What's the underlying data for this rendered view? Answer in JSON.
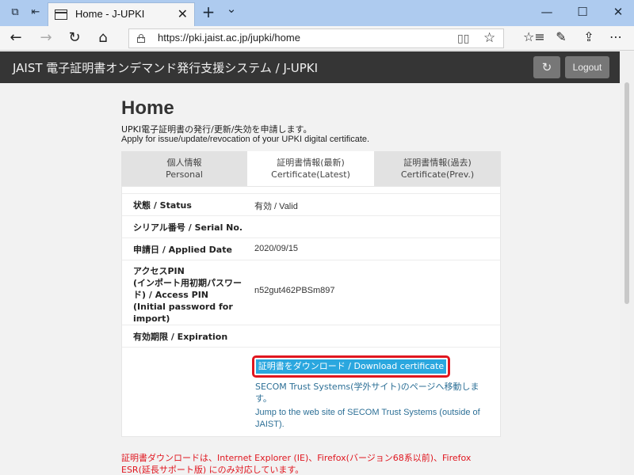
{
  "browser": {
    "tab_title": "Home - J-UPKI",
    "tab_close": "✕",
    "new_tab": "+",
    "tab_menu": "⌄",
    "url": "https://pki.jaist.ac.jp/jupki/home",
    "window_min": "—",
    "window_max": "☐",
    "window_close": "✕"
  },
  "app": {
    "title": "JAIST 電子証明書オンデマンド発行支援システム / J-UPKI",
    "refresh_icon": "↻",
    "logout_label": "Logout"
  },
  "page": {
    "heading": "Home",
    "desc_ja": "UPKI電子証明書の発行/更新/失効を申請します。",
    "desc_en": "Apply for issue/update/revocation of your UPKI digital certificate."
  },
  "tabs": [
    {
      "ja": "個人情報",
      "en": "Personal"
    },
    {
      "ja": "証明書情報(最新)",
      "en": "Certificate(Latest)"
    },
    {
      "ja": "証明書情報(過去)",
      "en": "Certificate(Prev.)"
    }
  ],
  "rows": [
    {
      "label": "状態 / Status",
      "value": "有効 / Valid"
    },
    {
      "label": "シリアル番号 / Serial No.",
      "value": ""
    },
    {
      "label": "申請日 / Applied Date",
      "value": "2020/09/15"
    },
    {
      "label": "アクセスPIN\n(インポート用初期パスワード) / Access PIN\n(Initial password for import)",
      "value": "n52gut462PBSm897"
    },
    {
      "label": "有効期限 / Expiration",
      "value": ""
    }
  ],
  "download": {
    "button": "証明書をダウンロード / Download certificate",
    "secom_ja": "SECOM Trust Systems(学外サイト)のページへ移動します。",
    "secom_en": "Jump to the web site of SECOM Trust Systems (outside of JAIST)."
  },
  "note": "証明書ダウンロードは、Internet Explorer (IE)、Firefox(バージョン68系以前)、Firefox ESR(延長サポート版) にのみ対応しています。"
}
